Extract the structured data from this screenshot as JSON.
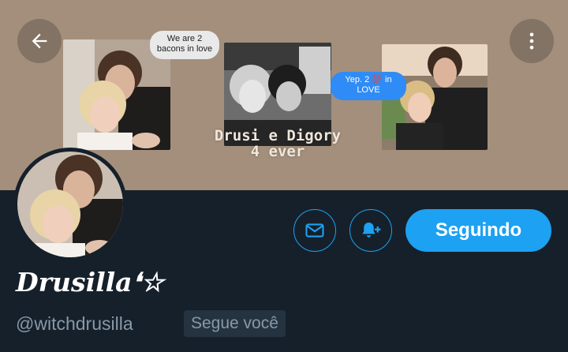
{
  "header": {
    "back_icon": "arrow-left-icon",
    "more_icon": "more-vertical-icon",
    "banner_color": "#a38f7b"
  },
  "banner": {
    "bubble_left": "We are 2 bacons in love",
    "bubble_right": "Yep. 2 💯 in LOVE",
    "caption_line1": "Drusi e Digory",
    "caption_line2": "4 ever"
  },
  "actions": {
    "message_icon": "envelope-icon",
    "notify_icon": "bell-plus-icon",
    "follow_label": "Seguindo",
    "accent": "#1da1f2"
  },
  "profile": {
    "display_name": "Drusilla❛☆",
    "handle": "@witchdrusilla",
    "follows_you": "Segue você"
  }
}
